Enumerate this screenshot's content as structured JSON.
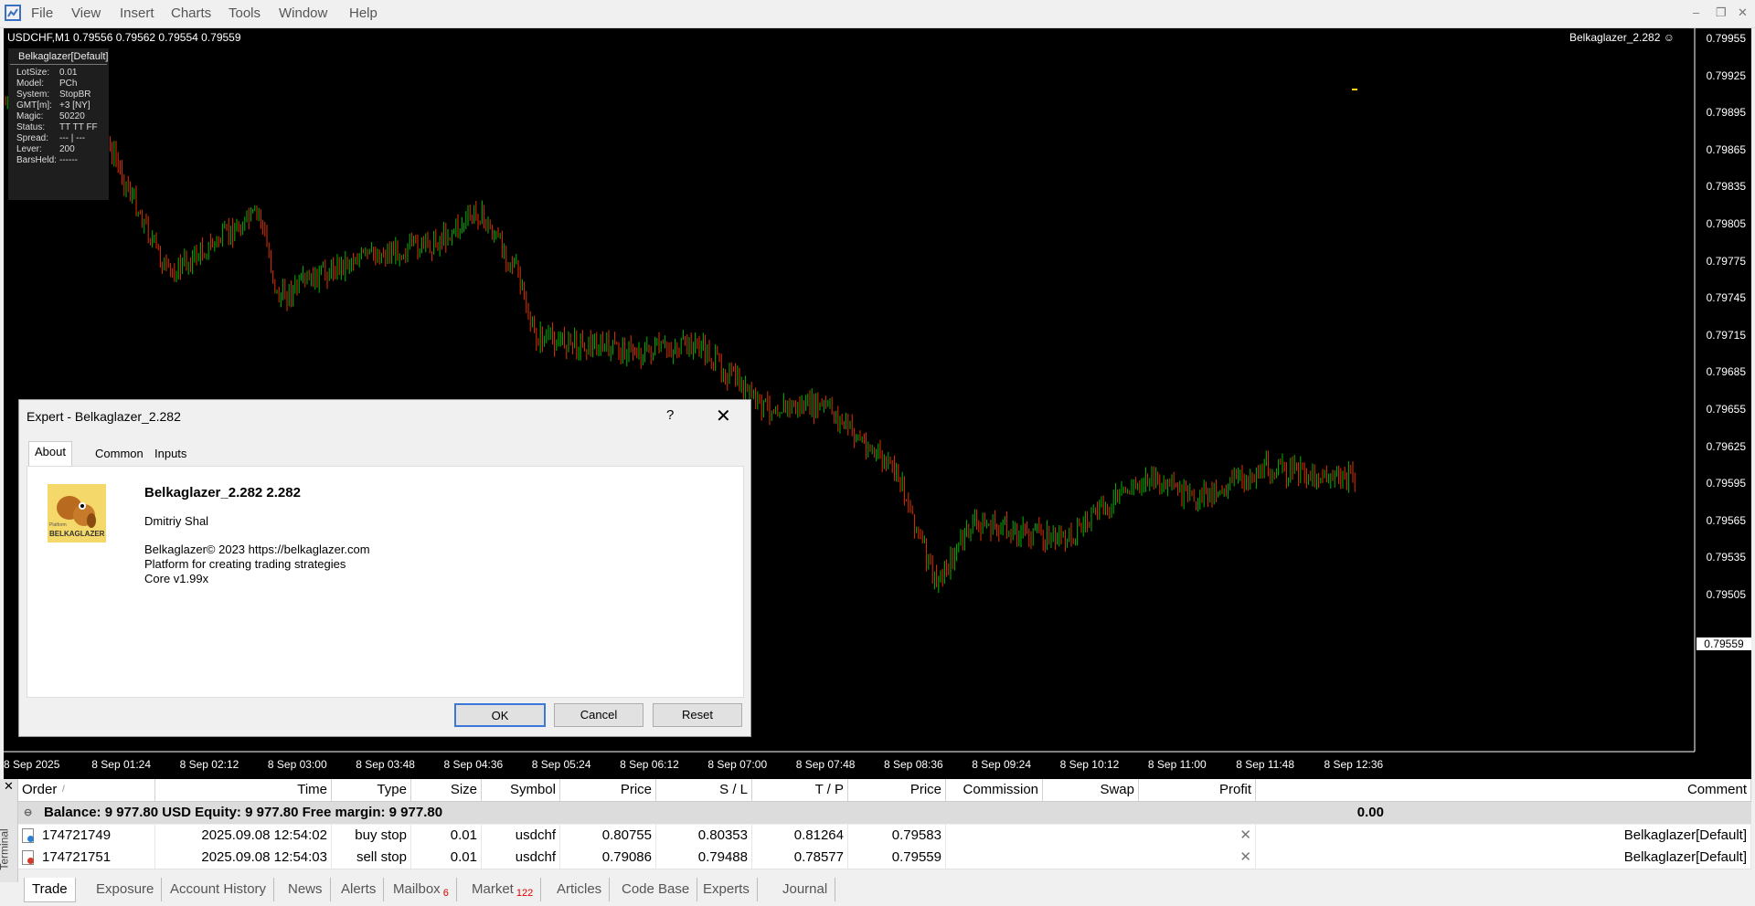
{
  "menu": [
    "File",
    "View",
    "Insert",
    "Charts",
    "Tools",
    "Window",
    "Help"
  ],
  "chart": {
    "header": "USDCHF,M1  0.79556 0.79562 0.79554 0.79559",
    "ea_label": "Belkaglazer_2.282 ☺",
    "panel": {
      "title": "Belkaglazer[Default]",
      "rows": [
        {
          "k": "LotSize:",
          "v": "0.01"
        },
        {
          "k": "Model:",
          "v": "PCh"
        },
        {
          "k": "System:",
          "v": "StopBR"
        },
        {
          "k": "GMT[m]:",
          "v": "+3 [NY]"
        },
        {
          "k": "Magic:",
          "v": "50220"
        },
        {
          "k": "Status:",
          "v": "TT TT FF"
        },
        {
          "k": "Spread:",
          "v": "--- | ---"
        },
        {
          "k": "Lever:",
          "v": "200"
        },
        {
          "k": "BarsHeld:",
          "v": "------"
        }
      ]
    },
    "price_labels": [
      "0.79955",
      "0.79925",
      "0.79895",
      "0.79865",
      "0.79835",
      "0.79805",
      "0.79775",
      "0.79745",
      "0.79715",
      "0.79685",
      "0.79655",
      "0.79625",
      "0.79595",
      "0.79565",
      "0.79535",
      "0.79505"
    ],
    "current_price": "0.79559",
    "time_labels": [
      "8 Sep 2025",
      "8 Sep 01:24",
      "8 Sep 02:12",
      "8 Sep 03:00",
      "8 Sep 03:48",
      "8 Sep 04:36",
      "8 Sep 05:24",
      "8 Sep 06:12",
      "8 Sep 07:00",
      "8 Sep 07:48",
      "8 Sep 08:36",
      "8 Sep 09:24",
      "8 Sep 10:12",
      "8 Sep 11:00",
      "8 Sep 11:48",
      "8 Sep 12:36"
    ],
    "colors": {
      "bull": "#00b400",
      "bear": "#e03000",
      "background": "#000000"
    }
  },
  "dialog": {
    "title": "Expert - Belkaglazer_2.282",
    "help": "?",
    "close": "✕",
    "tabs": [
      "About",
      "Common",
      "Inputs"
    ],
    "name": "Belkaglazer_2.282 2.282",
    "author": "Dmitriy Shal",
    "desc1": "Belkaglazer© 2023 https://belkaglazer.com",
    "desc2": "Platform for creating trading strategies",
    "desc3": "Core v1.99x",
    "logo_text_small": "Platform",
    "logo_text": "BELKAGLAZER",
    "buttons": {
      "ok": "OK",
      "cancel": "Cancel",
      "reset": "Reset"
    }
  },
  "terminal": {
    "side_label": "Terminal",
    "close": "✕",
    "columns": [
      "Order",
      "Time",
      "Type",
      "Size",
      "Symbol",
      "Price",
      "S / L",
      "T / P",
      "Price",
      "Commission",
      "Swap",
      "Profit",
      "Comment"
    ],
    "sort_marker": "/",
    "balance_text": "Balance: 9 977.80 USD  Equity: 9 977.80  Free margin: 9 977.80",
    "balance_profit": "0.00",
    "rows": [
      {
        "order": "174721749",
        "time": "2025.09.08 12:54:02",
        "type": "buy stop",
        "size": "0.01",
        "symbol": "usdchf",
        "price": "0.80755",
        "sl": "0.80353",
        "tp": "0.81264",
        "cur_price": "0.79583",
        "comment": "Belkaglazer[Default]"
      },
      {
        "order": "174721751",
        "time": "2025.09.08 12:54:03",
        "type": "sell stop",
        "size": "0.01",
        "symbol": "usdchf",
        "price": "0.79086",
        "sl": "0.79488",
        "tp": "0.78577",
        "cur_price": "0.79559",
        "comment": "Belkaglazer[Default]"
      }
    ],
    "tabs": [
      {
        "label": "Trade",
        "badge": ""
      },
      {
        "label": "Exposure",
        "badge": ""
      },
      {
        "label": "Account History",
        "badge": ""
      },
      {
        "label": "News",
        "badge": ""
      },
      {
        "label": "Alerts",
        "badge": ""
      },
      {
        "label": "Mailbox",
        "badge": "6"
      },
      {
        "label": "Market",
        "badge": "122"
      },
      {
        "label": "Articles",
        "badge": ""
      },
      {
        "label": "Code Base",
        "badge": ""
      },
      {
        "label": "Experts",
        "badge": ""
      },
      {
        "label": "Journal",
        "badge": ""
      }
    ]
  }
}
